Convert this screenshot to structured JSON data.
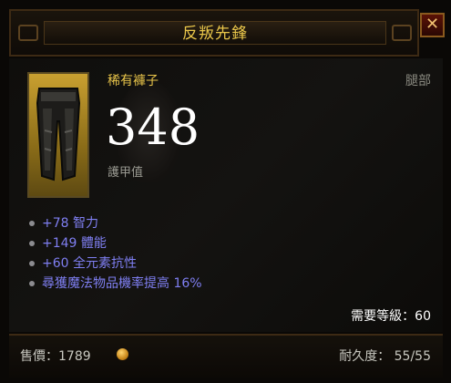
{
  "header": {
    "title": "反叛先鋒",
    "close_icon": "✕"
  },
  "item": {
    "type": "稀有褲子",
    "slot": "腿部",
    "armor_value": "348",
    "armor_label": "護甲值",
    "icon": "pants-icon"
  },
  "affixes": [
    {
      "text": "+78 智力"
    },
    {
      "text": "+149 體能"
    },
    {
      "text": "+60 全元素抗性"
    },
    {
      "text": "尋獲魔法物品機率提高 16%"
    }
  ],
  "requirement": {
    "text": "需要等級：60"
  },
  "footer": {
    "price_text": "售價：1789",
    "durability_text": "耐久度：  55/55"
  },
  "colors": {
    "title": "#e9c64a",
    "rare": "#e8c44a",
    "affix": "#7f7ff2",
    "close_button": "#5a1206"
  }
}
